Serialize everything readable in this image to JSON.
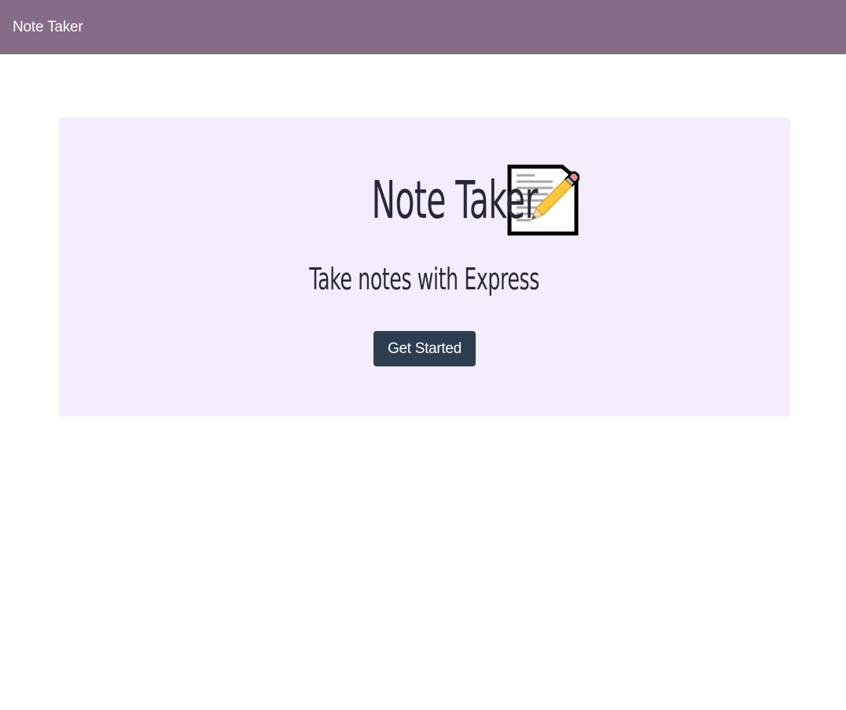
{
  "navbar": {
    "brand": "Note Taker"
  },
  "hero": {
    "title": "Note Taker",
    "icon": "memo-icon",
    "subtitle": "Take notes with Express",
    "button_label": "Get Started"
  },
  "colors": {
    "navbar_bg": "#866b87",
    "jumbotron_bg": "#f4edfe",
    "button_bg": "#2c3e50",
    "text_dark": "#272a36"
  }
}
